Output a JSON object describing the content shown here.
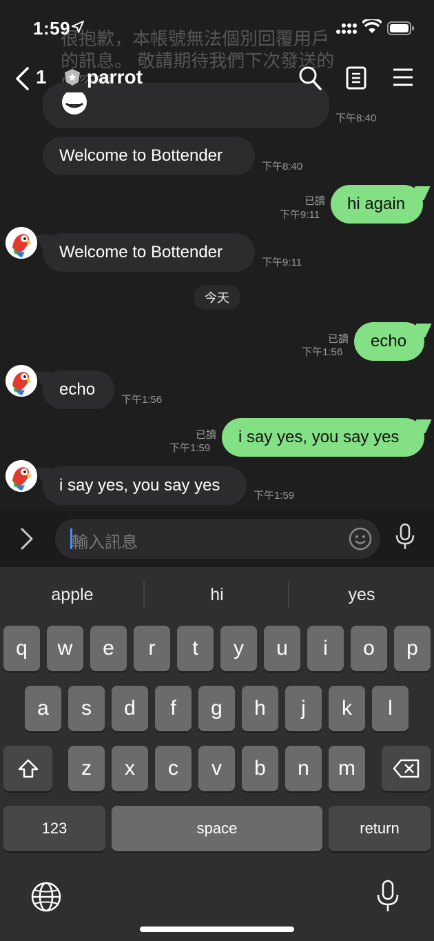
{
  "status_bar": {
    "time": "1:59"
  },
  "ghost_text": "很抱歉，本帳號無法個別回覆用戶的訊息。\n敬請期待我們下次發送的內容喔！",
  "header": {
    "unread_count": "1",
    "title": "parrot"
  },
  "messages": [
    {
      "who": "bot",
      "text": "Welcome to Bottender",
      "time": "下午8:40"
    },
    {
      "who": "me",
      "text": "hi again",
      "read": "已讀",
      "time": "下午9:11"
    },
    {
      "who": "bot",
      "text": "Welcome to Bottender",
      "time": "下午9:11"
    },
    {
      "who": "me",
      "text": "echo",
      "read": "已讀",
      "time": "下午1:56"
    },
    {
      "who": "bot",
      "text": "echo",
      "time": "下午1:56"
    },
    {
      "who": "me",
      "text": "i say yes, you say yes",
      "read": "已讀",
      "time": "下午1:59"
    },
    {
      "who": "bot",
      "text": "i say yes, you say yes",
      "time": "下午1:59"
    }
  ],
  "top_partial_time": "下午8:40",
  "date_divider": "今天",
  "input": {
    "placeholder": "輸入訊息"
  },
  "keyboard": {
    "predictions": [
      "apple",
      "hi",
      "yes"
    ],
    "row1": [
      "q",
      "w",
      "e",
      "r",
      "t",
      "y",
      "u",
      "i",
      "o",
      "p"
    ],
    "row2": [
      "a",
      "s",
      "d",
      "f",
      "g",
      "h",
      "j",
      "k",
      "l"
    ],
    "row3": [
      "z",
      "x",
      "c",
      "v",
      "b",
      "n",
      "m"
    ],
    "numbers_label": "123",
    "space_label": "space",
    "return_label": "return"
  },
  "colors": {
    "my_bubble": "#84e084",
    "bot_bubble": "#2c2c2e",
    "background": "#1e1e1e"
  }
}
